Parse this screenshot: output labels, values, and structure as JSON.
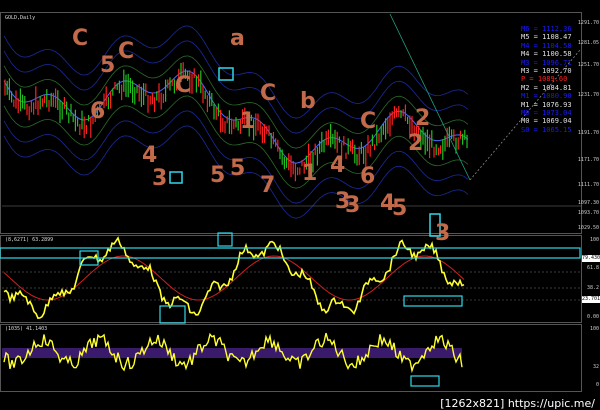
{
  "chart": {
    "symbol_title": "GOLD,Daily",
    "osc1_title": "(8,6271) 63.2899",
    "osc2_title": "(1035) 41.1403"
  },
  "price_axis": [
    "1291.70",
    "1281.05",
    "1251.70",
    "1231.70",
    "1191.70",
    "1171.70",
    "1111.70",
    "1097.30",
    "1093.70",
    "1029.50"
  ],
  "osc1_axis": [
    "100",
    "79.4301",
    "61.8",
    "38.2",
    "23.7015",
    "0.00"
  ],
  "osc2_axis": [
    "100",
    "32",
    "0"
  ],
  "osc1_tag_high": "79.4301",
  "osc1_tag_low": "23.7015",
  "levels": [
    {
      "label": "M6 = 1112.36",
      "color": "#1a1aff"
    },
    {
      "label": "M5 = 1108.47",
      "color": "#e0e0e0"
    },
    {
      "label": "M4 = 1104.58",
      "color": "#1a1aff"
    },
    {
      "label": "M4 = 1100.58",
      "color": "#e0e0e0"
    },
    {
      "label": "M3 = 1096.71",
      "color": "#1a1aff"
    },
    {
      "label": "M3 = 1092.70",
      "color": "#e0e0e0"
    },
    {
      "label": "P = 1089.60",
      "color": "#ff2020"
    },
    {
      "label": "M2 = 1084.81",
      "color": "#e0e0e0"
    },
    {
      "label": "M1 = 1080.90",
      "color": "#1a1aff"
    },
    {
      "label": "M1 = 1076.93",
      "color": "#e0e0e0"
    },
    {
      "label": "M0 = 1073.04",
      "color": "#1a1aff"
    },
    {
      "label": "M0 = 1069.04",
      "color": "#e0e0e0"
    },
    {
      "label": "S0 = 1065.15",
      "color": "#1a1aff"
    }
  ],
  "annotations": [
    "C",
    "5",
    "C",
    "6",
    "C",
    "a",
    "4",
    "b",
    "3",
    "5",
    "C",
    "1",
    "1",
    "4",
    "C",
    "2",
    "3",
    "4",
    "5",
    "7",
    "3",
    "3",
    "6",
    "5",
    "2"
  ],
  "watermark": "[1262x821] https://upic.me/",
  "colors": {
    "candle_up": "#20c020",
    "candle_down": "#ff2020",
    "annotation": "#c26a4a",
    "highlight": "#30d8e8",
    "osc_line": "#ffff30"
  }
}
